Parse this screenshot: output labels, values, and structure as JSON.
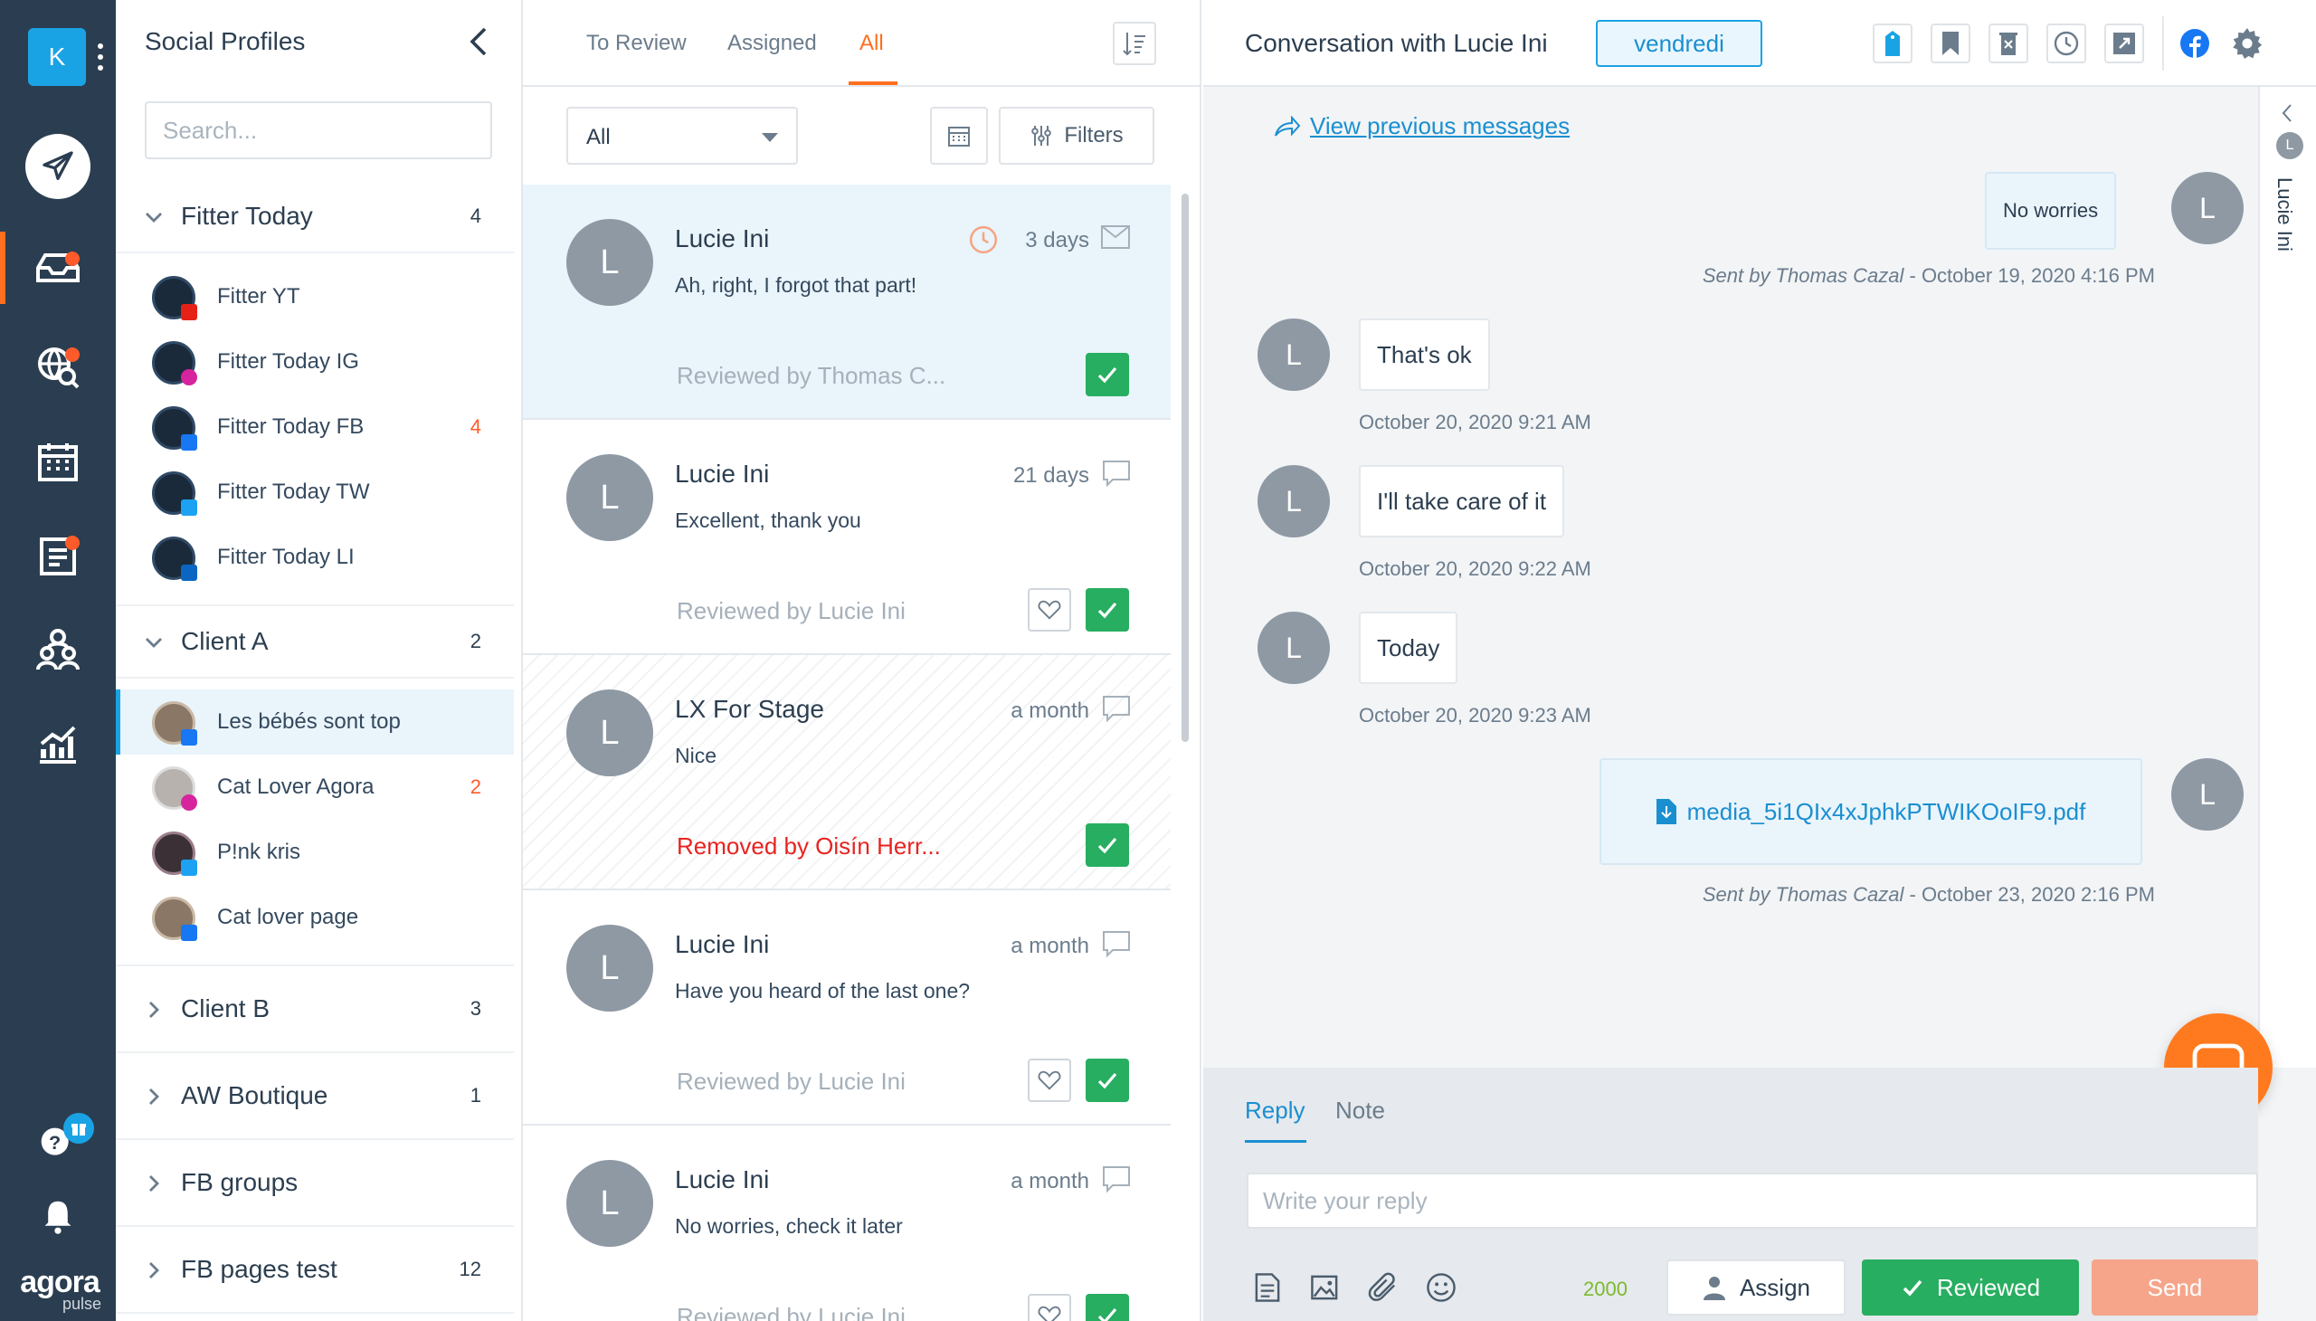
{
  "nav": {
    "avatar_letter": "K",
    "items": [
      "compose-icon",
      "inbox-icon",
      "listening-icon",
      "calendar-icon",
      "reports-list-icon",
      "team-icon",
      "analytics-icon"
    ],
    "logo_main": "agora",
    "logo_sub": "pulse",
    "accent_color": "#ff6f1f"
  },
  "profiles": {
    "title": "Social Profiles",
    "search_placeholder": "Search...",
    "groups": [
      {
        "name": "Fitter Today",
        "count": "4",
        "expanded": true,
        "items": [
          {
            "name": "Fitter YT",
            "network": "youtube",
            "count": ""
          },
          {
            "name": "Fitter Today IG",
            "network": "instagram",
            "count": ""
          },
          {
            "name": "Fitter Today FB",
            "network": "facebook",
            "count": "4"
          },
          {
            "name": "Fitter Today TW",
            "network": "twitter",
            "count": ""
          },
          {
            "name": "Fitter Today LI",
            "network": "linkedin",
            "count": ""
          }
        ]
      },
      {
        "name": "Client A",
        "count": "2",
        "expanded": true,
        "items": [
          {
            "name": "Les bébés sont top",
            "network": "facebook",
            "count": "",
            "selected": true
          },
          {
            "name": "Cat Lover Agora",
            "network": "instagram",
            "count": "2"
          },
          {
            "name": "P!nk kris",
            "network": "twitter",
            "count": ""
          },
          {
            "name": "Cat lover page",
            "network": "facebook",
            "count": ""
          }
        ]
      },
      {
        "name": "Client B",
        "count": "3",
        "expanded": false
      },
      {
        "name": "AW Boutique",
        "count": "1",
        "expanded": false
      },
      {
        "name": "FB groups",
        "count": "",
        "expanded": false
      },
      {
        "name": "FB pages test",
        "count": "12",
        "expanded": false
      }
    ]
  },
  "list": {
    "tabs": [
      "To Review",
      "Assigned",
      "All"
    ],
    "active_tab": "All",
    "filter_value": "All",
    "filters_label": "Filters",
    "conversations": [
      {
        "avatar": "L",
        "name": "Lucie Ini",
        "message": "Ah, right, I forgot that part!",
        "time": "3 days",
        "type": "message",
        "status": "Reviewed by Thomas C...",
        "selected": true,
        "heart": false
      },
      {
        "avatar": "L",
        "name": "Lucie Ini",
        "message": "Excellent, thank you",
        "time": "21 days",
        "type": "comment",
        "status": "Reviewed by Lucie Ini",
        "heart": true
      },
      {
        "avatar": "L",
        "name": "LX For Stage",
        "message": "Nice",
        "time": "a month",
        "type": "comment",
        "status": "Removed by Oisín Herr...",
        "removed": true,
        "heart": false
      },
      {
        "avatar": "L",
        "name": "Lucie Ini",
        "message": "Have you heard of the last one?",
        "time": "a month",
        "type": "comment",
        "status": "Reviewed by Lucie Ini",
        "heart": true
      },
      {
        "avatar": "L",
        "name": "Lucie Ini",
        "message": "No worries, check it later",
        "time": "a month",
        "type": "comment",
        "status": "Reviewed by Lucie Ini",
        "heart": true
      }
    ]
  },
  "detail": {
    "title": "Conversation with Lucie Ini",
    "tag": "vendredi",
    "side_name": "Lucie Ini",
    "side_avatar": "L",
    "view_previous": "View previous messages",
    "messages": [
      {
        "dir": "out",
        "text": "No worries",
        "meta_by": "Sent by Thomas Cazal",
        "meta_date": " - October 19, 2020 4:16 PM"
      },
      {
        "dir": "in",
        "text": "That's ok",
        "meta_date": "October 20, 2020 9:21 AM"
      },
      {
        "dir": "in",
        "text": "I'll take care of it",
        "meta_date": "October 20, 2020 9:22 AM"
      },
      {
        "dir": "in",
        "text": "Today",
        "meta_date": "October 20, 2020 9:23 AM"
      },
      {
        "dir": "out",
        "file": "media_5i1QIx4xJphkPTWIKOoIF9.pdf",
        "meta_by": "Sent by Thomas Cazal",
        "meta_date": " - October 23, 2020 2:16 PM"
      }
    ],
    "avatar_letter": "L"
  },
  "composer": {
    "tabs": [
      "Reply",
      "Note"
    ],
    "active_tab": "Reply",
    "placeholder": "Write your reply",
    "char_count": "2000",
    "assign_label": "Assign",
    "reviewed_label": "Reviewed",
    "send_label": "Send"
  }
}
